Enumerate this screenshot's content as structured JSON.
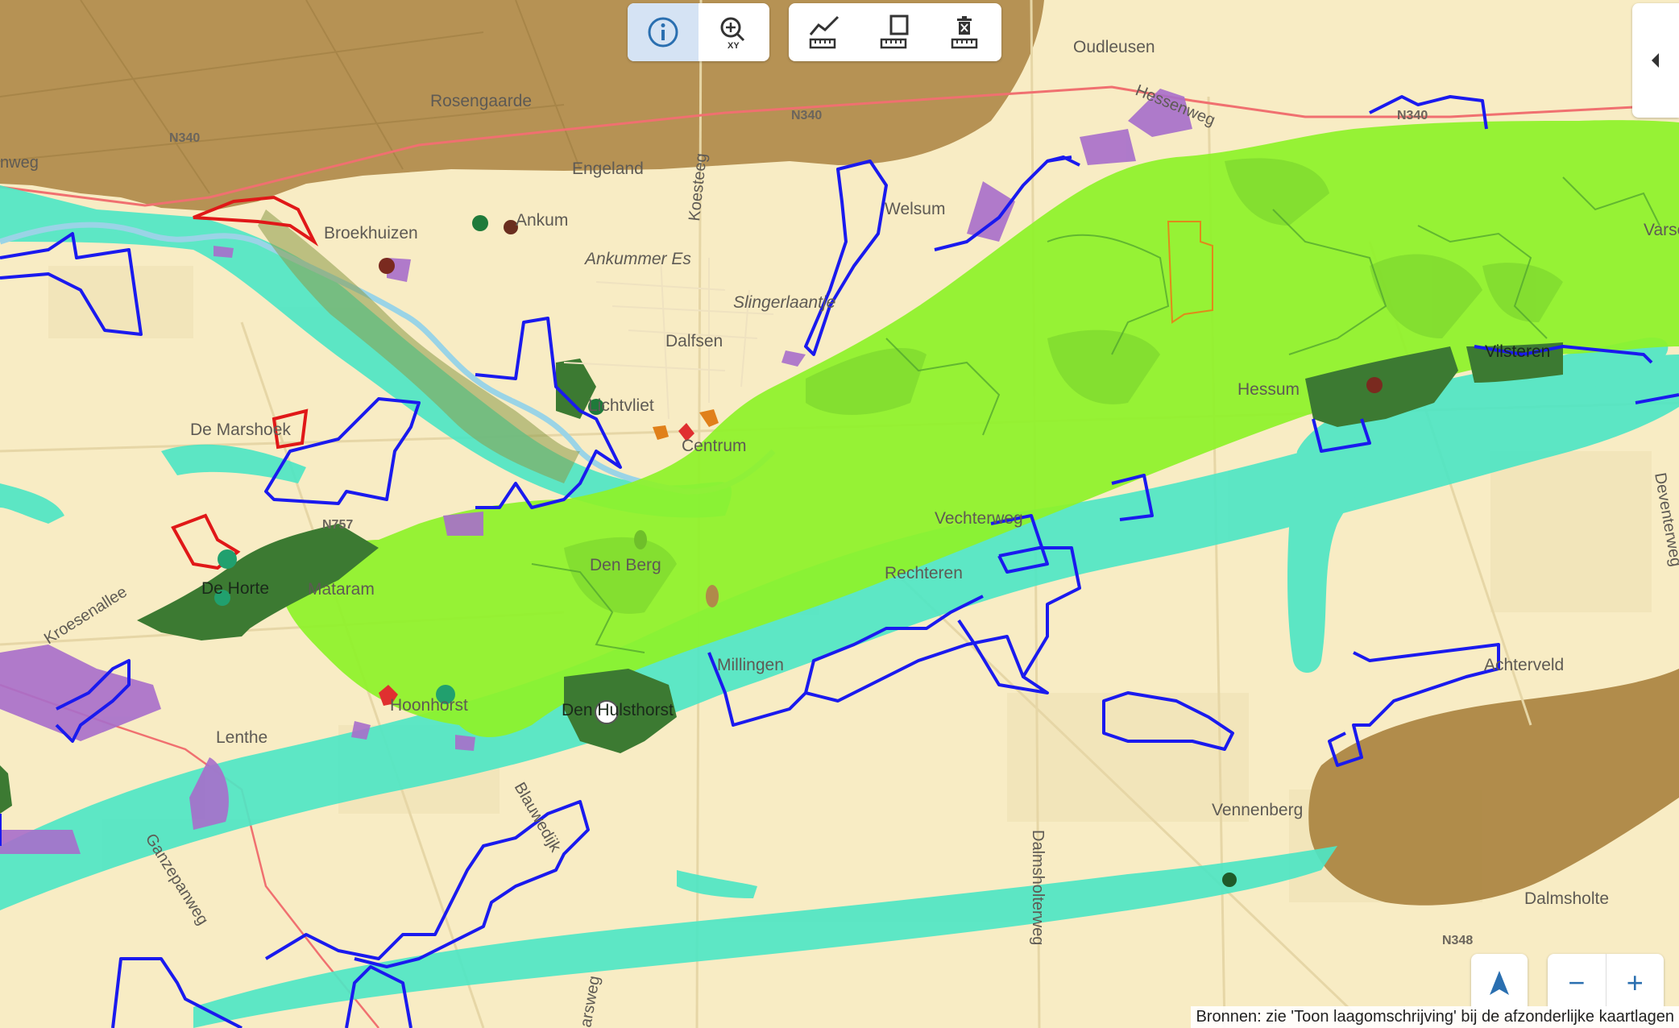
{
  "toolbar_info": {
    "info": "info-icon",
    "zoom_xy": "zoom-coordinate-icon"
  },
  "toolbar_measure": {
    "line": "measure-line-icon",
    "area": "measure-area-icon",
    "delete": "delete-measurement-icon"
  },
  "panel_toggle": "chevron-left-icon",
  "controls": {
    "locate": "navigation-arrow-icon",
    "zoom_out": "−",
    "zoom_in": "+"
  },
  "attribution": "Bronnen: zie 'Toon laagomschrijving' bij de afzonderlijke kaartlagen",
  "colors": {
    "base": "#f8ecc4",
    "brown_zone": "#b08a4a",
    "turquoise_zone": "#4fe6c4",
    "lime_zone": "#8ef22a",
    "dark_green": "#3c7a32",
    "blue_outline": "#1a1aee",
    "red_outline": "#e01818",
    "purple": "#a76ecb",
    "river": "#9ad4e6"
  },
  "places": {
    "oudleusen": "Oudleusen",
    "rosengaarde": "Rosengaarde",
    "engeland": "Engeland",
    "broekhuizen": "Broekhuizen",
    "ankum": "Ankum",
    "ankummer_es": "Ankummer Es",
    "dalfsen": "Dalfsen",
    "slingerlaantje": "Slingerlaantje",
    "welsum": "Welsum",
    "lichtvliet": "Lichtvliet",
    "centrum": "Centrum",
    "de_marshoek": "De Marshoek",
    "de_horte": "De Horte",
    "mataram": "Mataram",
    "den_berg": "Den Berg",
    "rechteren": "Rechteren",
    "millingen": "Millingen",
    "den_hulsthorst": "Den Hulsthorst",
    "lenthe": "Lenthe",
    "hoonhorst": "Hoonhorst",
    "vilsteren": "Vilsteren",
    "hessum": "Hessum",
    "vennenberg": "Vennenberg",
    "achterveld": "Achterveld",
    "dalmsholte": "Dalmsholte",
    "vechterweg": "Vechterweg",
    "varsen": "Varsen"
  },
  "roads": {
    "n340_a": "N340",
    "n340_b": "N340",
    "n340_c": "N340",
    "n757": "N757",
    "n348": "N348",
    "hessenweg": "Hessenweg",
    "koesteeg": "Koesteeg",
    "kroesenallee": "Kroesenallee",
    "blauwedijk": "Blauwedijk",
    "ganzepanweg": "Ganzepanweg",
    "dalmsholterweg": "Dalmsholterweg",
    "deventerweg": "Deventerweg",
    "emweg": "nweg",
    "arsweg": "arsweg"
  }
}
